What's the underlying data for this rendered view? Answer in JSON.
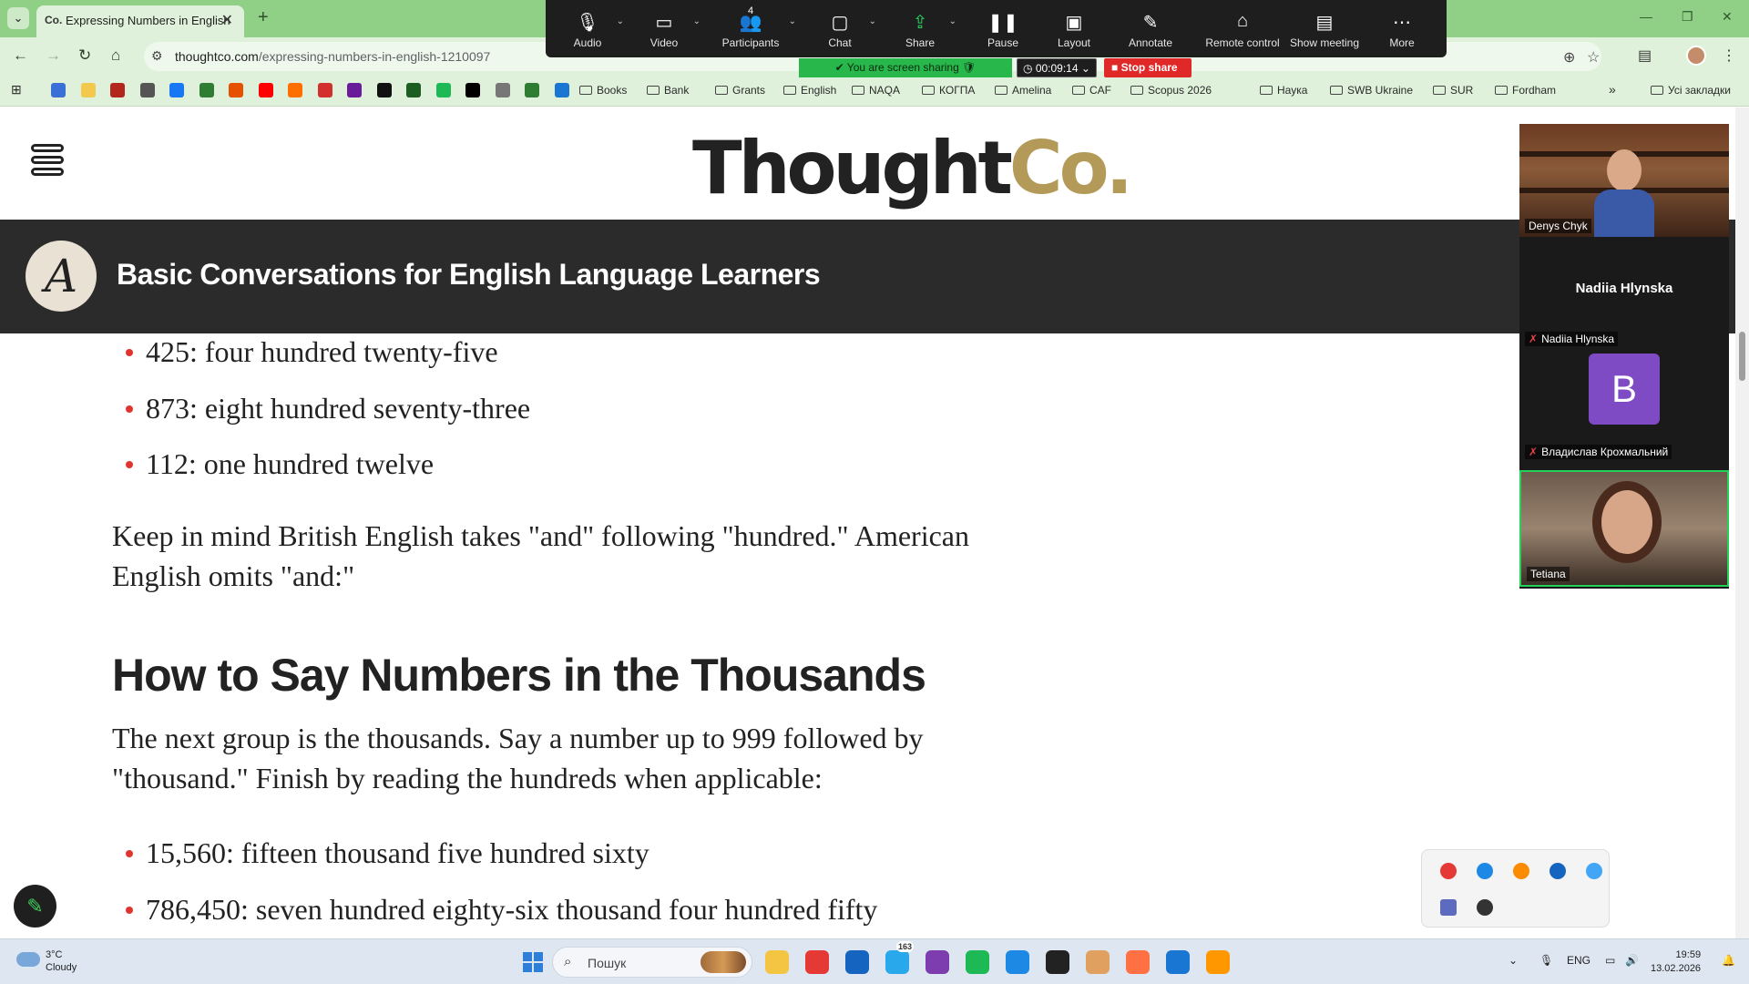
{
  "browser": {
    "tab_favicon": "Co.",
    "tab_title": "Expressing Numbers in English",
    "url_domain": "thoughtco.com",
    "url_path": "/expressing-numbers-in-english-1210097",
    "bookmarks": [
      "Books",
      "Bank",
      "Grants",
      "English",
      "NAQA",
      "КОГПА",
      "Amelina",
      "CAF",
      "Scopus 2026",
      "Наука",
      "SWB Ukraine",
      "SUR",
      "Fordham"
    ],
    "all_bookmarks": "Усі закладки",
    "bookmark_icon_colors": [
      "#3b6fd8",
      "#f2c94c",
      "#b3261e",
      "#555555",
      "#1877f2",
      "#2e7d32",
      "#e65100",
      "#ff0000",
      "#ff6f00",
      "#d32f2f",
      "#6a1b9a",
      "#111111",
      "#1b5e20",
      "#1db954",
      "#000000",
      "#777777",
      "#2e7d32",
      "#1976d2"
    ]
  },
  "zoom": {
    "toolbar": [
      {
        "icon": "microphone-icon",
        "label": "Audio",
        "caret": true
      },
      {
        "icon": "video-camera-icon",
        "label": "Video",
        "caret": true
      },
      {
        "icon": "participants-icon",
        "label": "Participants",
        "caret": true,
        "count": "4"
      },
      {
        "icon": "chat-icon",
        "label": "Chat",
        "caret": true
      },
      {
        "icon": "share-screen-icon",
        "label": "Share",
        "caret": true
      },
      {
        "icon": "pause-icon",
        "label": "Pause",
        "caret": false
      },
      {
        "icon": "layout-icon",
        "label": "Layout",
        "caret": false
      },
      {
        "icon": "annotate-icon",
        "label": "Annotate",
        "caret": false
      },
      {
        "icon": "remote-control-icon",
        "label": "Remote control",
        "caret": false
      },
      {
        "icon": "show-meeting-icon",
        "label": "Show meeting",
        "caret": false
      },
      {
        "icon": "more-icon",
        "label": "More",
        "caret": false
      }
    ],
    "sharing_status": "You are screen sharing",
    "timer": "00:09:14",
    "stop_share": "Stop share",
    "participants": [
      {
        "name": "Denys Chyk"
      },
      {
        "name": "Nadiia Hlynska",
        "big_name": "Nadiia Hlynska"
      },
      {
        "name": "Владислав Крохмальний",
        "initial": "B"
      },
      {
        "name": "Tetiana"
      }
    ]
  },
  "site": {
    "logo_main": "Thought",
    "logo_accent": "Co.",
    "series_logo": "A",
    "series_title": "Basic Conversations for English Language Learners",
    "list_hundreds": [
      "425: four hundred twenty-five",
      "873: eight hundred seventy-three",
      "112: one hundred twelve"
    ],
    "para1": "Keep in mind British English takes \"and\" following \"hundred.\" American English omits \"and:\"",
    "heading": "How to Say Numbers in the Thousands",
    "para2": "The next group is the thousands. Say a number up to 999 followed by \"thousand.\" Finish by reading the hundreds when applicable:",
    "list_thousands": [
      "15,560: fifteen thousand five hundred sixty",
      "786,450: seven hundred eighty-six thousand four hundred fifty"
    ]
  },
  "taskbar": {
    "temperature": "3°C",
    "condition": "Cloudy",
    "search_placeholder": "Пошук",
    "language": "ENG",
    "time": "19:59",
    "date": "13.02.2026",
    "telegram_badge": "163"
  }
}
